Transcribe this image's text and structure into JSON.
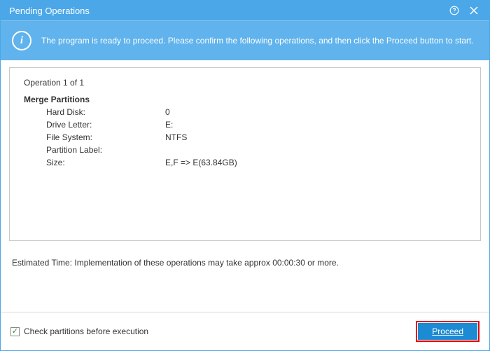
{
  "title": "Pending Operations",
  "banner": {
    "text": "The program is ready to proceed. Please confirm the following operations, and then click the Proceed button to start."
  },
  "operation": {
    "heading": "Operation 1 of 1",
    "title": "Merge Partitions",
    "details": [
      {
        "label": "Hard Disk:",
        "value": "0"
      },
      {
        "label": "Drive Letter:",
        "value": "E:"
      },
      {
        "label": "File System:",
        "value": "NTFS"
      },
      {
        "label": "Partition Label:",
        "value": ""
      },
      {
        "label": "Size:",
        "value": "E,F => E(63.84GB)"
      }
    ]
  },
  "estimate": "Estimated Time: Implementation of these operations may take approx 00:00:30 or more.",
  "footer": {
    "checkbox_label": "Check partitions before execution",
    "checkbox_checked": true,
    "proceed_label": "Proceed"
  }
}
